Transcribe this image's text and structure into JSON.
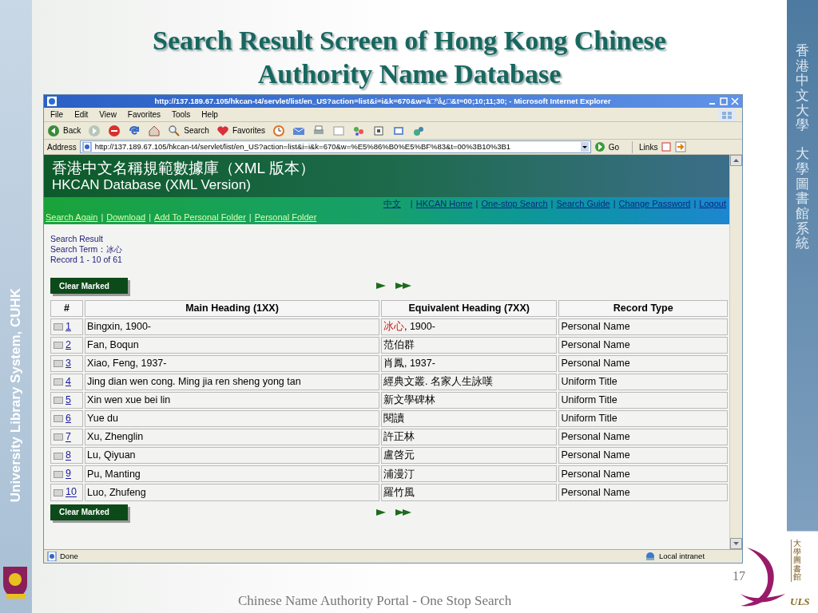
{
  "slide": {
    "title": "Search Result Screen of Hong Kong Chinese Authority Name Database",
    "side_label": "University Library System, CUHK",
    "right_labels": [
      "香港中文大學",
      "大學圖書館系統"
    ],
    "page_number": "17",
    "footer": "Chinese Name Authority Portal - One Stop Search",
    "logo_zh": "大學圖書館",
    "logo_abbr": "ULS"
  },
  "browser": {
    "title": "http://137.189.67.105/hkcan-t4/servlet/list/en_US?action=list&i=i&k=670&w=å□ºå¿□&t=00;10;11;30; - Microsoft Internet Explorer",
    "menu": [
      "File",
      "Edit",
      "View",
      "Favorites",
      "Tools",
      "Help"
    ],
    "toolbar": [
      {
        "kind": "back",
        "label": "Back"
      },
      {
        "kind": "forward"
      },
      {
        "kind": "stop"
      },
      {
        "kind": "refresh"
      },
      {
        "kind": "home"
      },
      {
        "kind": "search",
        "label": "Search"
      },
      {
        "kind": "favorites",
        "label": "Favorites"
      },
      {
        "kind": "history"
      },
      {
        "kind": "mail"
      },
      {
        "kind": "print"
      },
      {
        "kind": "edit"
      },
      {
        "kind": "discuss"
      },
      {
        "kind": "messenger"
      },
      {
        "kind": "research"
      },
      {
        "kind": "tools"
      }
    ],
    "address": {
      "label": "Address",
      "value": "http://137.189.67.105/hkcan-t4/servlet/list/en_US?action=list&i=i&k=670&w=%E5%86%B0%E5%BF%83&t=00%3B10%3B1"
    },
    "go": "Go",
    "links": "Links",
    "status": {
      "text": "Done",
      "zone": "Local intranet"
    }
  },
  "page": {
    "banner_zh": "香港中文名稱規範數據庫（XML 版本）",
    "banner_en": "HKCAN Database (XML Version)",
    "nav_links": [
      "中文",
      "HKCAN Home",
      "One-stop Search",
      "Search Guide",
      "Change Password",
      "Logout"
    ],
    "action_links": [
      "Search Again",
      "Download",
      "Add To Personal Folder",
      "Personal Folder"
    ],
    "link_separator": "|",
    "result_title": "Search Result",
    "search_term_label": "Search Term：",
    "search_term": "冰心",
    "record_range": "Record 1 - 10 of 61",
    "clear_button": "Clear Marked",
    "table": {
      "columns": [
        "#",
        "Main Heading (1XX)",
        "Equivalent Heading (7XX)",
        "Record Type"
      ],
      "rows": [
        {
          "checked": false,
          "number": "1",
          "main": "Bingxin, 1900-",
          "matched": "冰心",
          "equivalent": ", 1900-",
          "type": "Personal Name"
        },
        {
          "checked": false,
          "number": "2",
          "main": "Fan, Boqun",
          "equivalent": "范伯群",
          "type": "Personal Name"
        },
        {
          "checked": false,
          "number": "3",
          "main": "Xiao, Feng, 1937-",
          "equivalent": "肖鳳, 1937-",
          "type": "Personal Name"
        },
        {
          "checked": false,
          "number": "4",
          "main": "Jing dian wen cong. Ming jia ren sheng yong tan",
          "equivalent": "經典文叢. 名家人生詠嘆",
          "type": "Uniform Title"
        },
        {
          "checked": false,
          "number": "5",
          "main": "Xin wen xue bei lin",
          "equivalent": "新文學碑林",
          "type": "Uniform Title"
        },
        {
          "checked": false,
          "number": "6",
          "main": "Yue du",
          "equivalent": "閱讀",
          "type": "Uniform Title"
        },
        {
          "checked": false,
          "number": "7",
          "main": "Xu, Zhenglin",
          "equivalent": "許正林",
          "type": "Personal Name"
        },
        {
          "checked": false,
          "number": "8",
          "main": "Lu, Qiyuan",
          "equivalent": "盧啓元",
          "type": "Personal Name"
        },
        {
          "checked": false,
          "number": "9",
          "main": "Pu, Manting",
          "equivalent": "浦漫汀",
          "type": "Personal Name"
        },
        {
          "checked": false,
          "number": "10",
          "main": "Luo, Zhufeng",
          "equivalent": "羅竹風",
          "type": "Personal Name"
        }
      ]
    },
    "bottom_clear_button": "Clear Marked"
  }
}
